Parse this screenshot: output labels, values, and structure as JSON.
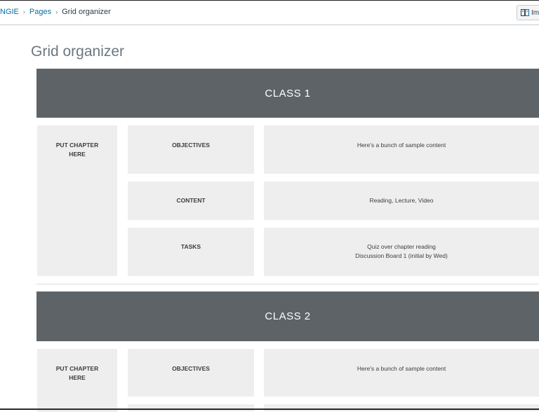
{
  "breadcrumb": {
    "course": "NGIE",
    "pages": "Pages",
    "current": "Grid organizer",
    "separator": "›"
  },
  "toolbar": {
    "immersive_reader_label": "Immersive Reader"
  },
  "page": {
    "title": "Grid organizer"
  },
  "classes": [
    {
      "title": "CLASS 1",
      "chapter": "PUT CHAPTER HERE",
      "rows": [
        {
          "label": "OBJECTIVES",
          "content": [
            "Here's a bunch of sample content"
          ]
        },
        {
          "label": "CONTENT",
          "content": [
            "Reading, Lecture, Video"
          ]
        },
        {
          "label": "TASKS",
          "content": [
            "Quiz over chapter reading",
            "Discussion Board 1 (initial by Wed)"
          ]
        }
      ]
    },
    {
      "title": "CLASS 2",
      "chapter": "PUT CHAPTER HERE",
      "rows": [
        {
          "label": "OBJECTIVES",
          "content": [
            "Here's a bunch of sample content"
          ]
        }
      ]
    }
  ],
  "colors": {
    "header_bg": "#5e6367",
    "cell_bg": "#eeeeee",
    "link": "#0770a3"
  }
}
